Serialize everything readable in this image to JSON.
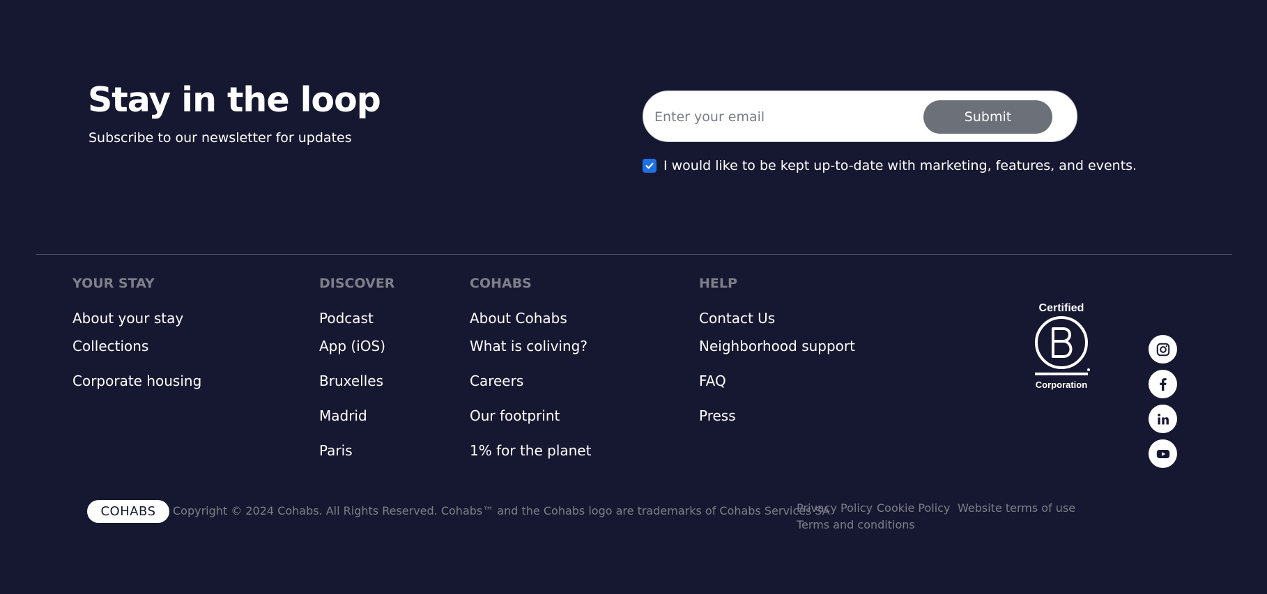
{
  "newsletter": {
    "title": "Stay in the loop",
    "subtitle": "Subscribe to our newsletter for updates",
    "email_placeholder": "Enter your email",
    "email_value": "",
    "submit_label": "Submit",
    "consent_checked": true,
    "consent_label": "I would like to be kept up-to-date with marketing, features, and events."
  },
  "footer": {
    "columns": [
      {
        "title": "YOUR STAY",
        "links": [
          "About your stay",
          "Collections",
          "Corporate housing"
        ]
      },
      {
        "title": "DISCOVER",
        "links": [
          "Podcast",
          "App (iOS)",
          "Bruxelles",
          "Madrid",
          "Paris"
        ]
      },
      {
        "title": "COHABS",
        "links": [
          "About Cohabs",
          "What is coliving?",
          "Careers",
          "Our footprint",
          "1% for the planet"
        ]
      },
      {
        "title": "HELP",
        "links": [
          "Contact Us",
          "Neighborhood support",
          "FAQ",
          "Press"
        ]
      }
    ],
    "certification": {
      "top": "Certified",
      "bottom": "Corporation",
      "icon": "b-corp-logo"
    },
    "social": [
      {
        "name": "instagram",
        "icon": "instagram-icon"
      },
      {
        "name": "facebook",
        "icon": "facebook-icon"
      },
      {
        "name": "linkedin",
        "icon": "linkedin-icon"
      },
      {
        "name": "youtube",
        "icon": "youtube-icon"
      }
    ]
  },
  "bottom": {
    "logo": "COHABS",
    "copyright": "Copyright © 2024 Cohabs. All Rights Reserved. Cohabs™ and the Cohabs logo are trademarks of Cohabs Services SA",
    "legal_links": [
      "Privacy Policy",
      "Cookie Policy",
      "Website terms of use",
      "Terms and conditions"
    ]
  },
  "colors": {
    "background": "#161831",
    "accent": "#1f6fe5",
    "submit_button": "#6b7079",
    "muted_text": "#7d7f8a"
  }
}
